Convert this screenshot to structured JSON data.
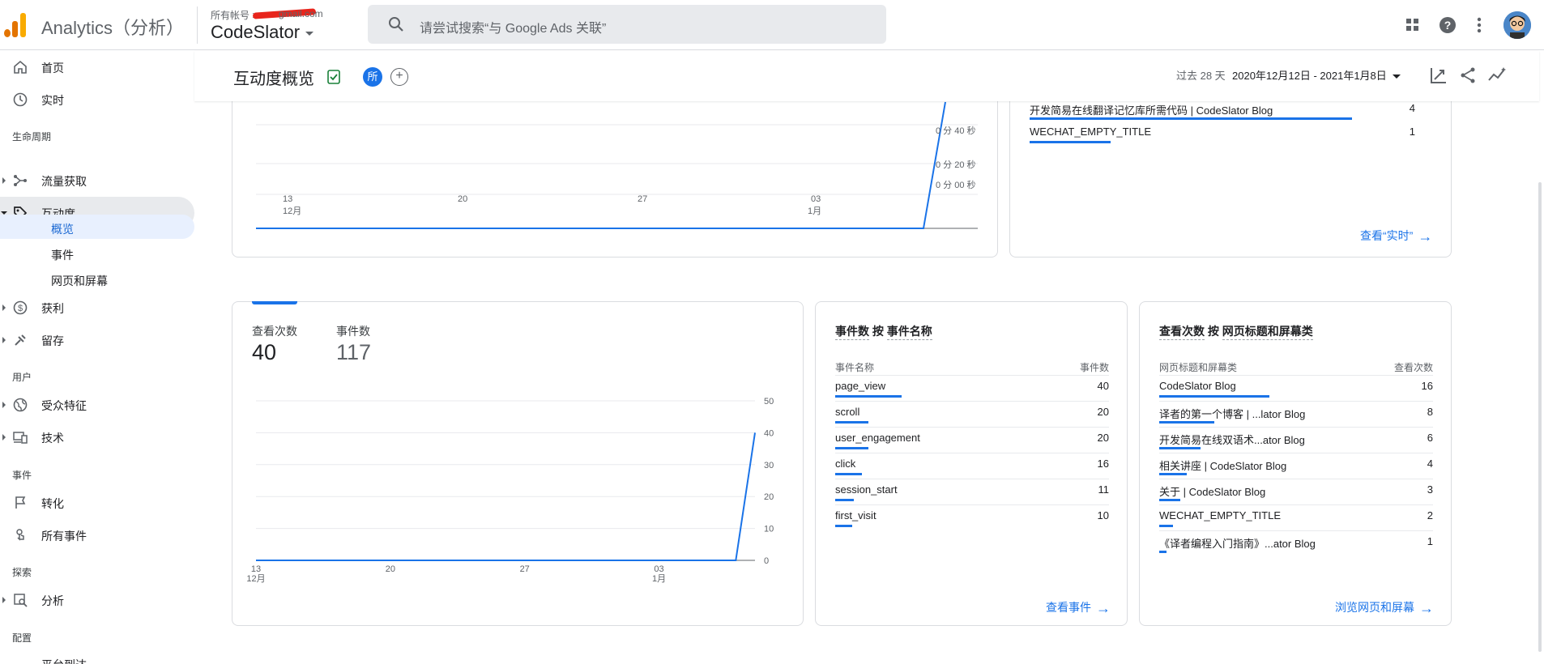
{
  "app": {
    "title": "Analytics（分析）",
    "account_label": "所有帐号 >",
    "account_email": "gmail.com",
    "property": "CodeSlator"
  },
  "search": {
    "placeholder": "请尝试搜索“与 Google Ads 关联”"
  },
  "sidebar": {
    "items": [
      {
        "label": "首页",
        "icon": "home-icon"
      },
      {
        "label": "实时",
        "icon": "clock-icon"
      },
      {
        "label": "流量获取",
        "icon": "acquisition-icon"
      },
      {
        "label": "互动度",
        "icon": "engagement-icon"
      },
      {
        "label": "获利",
        "icon": "dollar-icon"
      },
      {
        "label": "留存",
        "icon": "retention-icon"
      },
      {
        "label": "受众特征",
        "icon": "globe-icon"
      },
      {
        "label": "技术",
        "icon": "devices-icon"
      },
      {
        "label": "转化",
        "icon": "flag-icon"
      },
      {
        "label": "所有事件",
        "icon": "touch-icon"
      },
      {
        "label": "分析",
        "icon": "explore-icon"
      }
    ],
    "sub_items": [
      "概览",
      "事件",
      "网页和屏幕"
    ],
    "sections": [
      "生命周期",
      "用户",
      "事件",
      "探索",
      "配置"
    ],
    "cut_item": "平台到达"
  },
  "header": {
    "title": "互动度概览",
    "chip": "所",
    "add": "+",
    "period": "过去 28 天",
    "date_range": "2020年12月12日 - 2021年1月8日"
  },
  "top_chart": {
    "y_ticks": [
      "0 分 40 秒",
      "0 分 20 秒",
      "0 分 00 秒"
    ],
    "x_ticks": [
      "13",
      "20",
      "27",
      "03"
    ],
    "x_months": [
      "12月",
      "1月"
    ]
  },
  "top_right": {
    "rows": [
      {
        "name": "开发简易在线翻译记忆库所需代码 | CodeSlator Blog",
        "value": "4"
      },
      {
        "name": "WECHAT_EMPTY_TITLE",
        "value": "1"
      }
    ],
    "link": "查看“实时”"
  },
  "kpis": [
    {
      "label": "查看次数",
      "value": "40"
    },
    {
      "label": "事件数",
      "value": "117"
    }
  ],
  "chart_data": {
    "type": "line",
    "x": [
      "12-13",
      "12-20",
      "12-27",
      "01-03",
      "01-07",
      "01-08"
    ],
    "series": [
      {
        "values": [
          0,
          0,
          0,
          0,
          0,
          40
        ]
      }
    ],
    "x_ticks": [
      "13",
      "20",
      "27",
      "03"
    ],
    "x_months": [
      "12月",
      "1月"
    ],
    "y_ticks": [
      "50",
      "40",
      "30",
      "20",
      "10",
      "0"
    ],
    "ylim": [
      0,
      50
    ],
    "color": "#1a73e8"
  },
  "events_card": {
    "title_metric": "事件数",
    "title_by": "按",
    "title_dim": "事件名称",
    "col_name": "事件名称",
    "col_value": "事件数",
    "rows": [
      {
        "name": "page_view",
        "value": "40"
      },
      {
        "name": "scroll",
        "value": "20"
      },
      {
        "name": "user_engagement",
        "value": "20"
      },
      {
        "name": "click",
        "value": "16"
      },
      {
        "name": "session_start",
        "value": "11"
      },
      {
        "name": "first_visit",
        "value": "10"
      }
    ],
    "link": "查看事件"
  },
  "pages_card": {
    "title_metric": "查看次数",
    "title_by": "按",
    "title_dim": "网页标题和屏幕类",
    "col_name": "网页标题和屏幕类",
    "col_value": "查看次数",
    "rows": [
      {
        "name": "CodeSlator Blog",
        "value": "16"
      },
      {
        "name": "译者的第一个博客 | ...lator Blog",
        "value": "8"
      },
      {
        "name": "开发简易在线双语术...ator Blog",
        "value": "6"
      },
      {
        "name": "相关讲座 | CodeSlator Blog",
        "value": "4"
      },
      {
        "name": "关于 | CodeSlator Blog",
        "value": "3"
      },
      {
        "name": "WECHAT_EMPTY_TITLE",
        "value": "2"
      },
      {
        "name": "《译者编程入门指南》...ator Blog",
        "value": "1"
      }
    ],
    "link": "浏览网页和屏幕"
  },
  "colors": {
    "accent": "#1a73e8",
    "logo": [
      "#f9ab00",
      "#e37400",
      "#e37400"
    ]
  }
}
